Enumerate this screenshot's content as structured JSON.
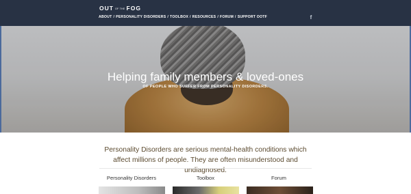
{
  "header": {
    "logo": {
      "word1": "OUT",
      "small": "OF THE",
      "word2": "FOG"
    },
    "nav": [
      "ABOUT",
      "PERSONALITY DISORDERS",
      "TOOLBOX",
      "RESOURCES",
      "FORUM",
      "SUPPORT OOTF"
    ],
    "nav_separator": "/",
    "social_icon": "f"
  },
  "hero": {
    "title": "Helping family members & loved-ones",
    "subtitle": "OF PEOPLE WHO SUFFER FROM PERSONALITY DISORDERS."
  },
  "intro": {
    "text": "Personality Disorders are serious mental-health conditions which affect millions of people. They are often misunderstood and undiagnosed."
  },
  "sections": [
    {
      "title": "Personality Disorders"
    },
    {
      "title": "Toolbox"
    },
    {
      "title": "Forum"
    }
  ],
  "colors": {
    "header_bg": "#283244",
    "intro_text": "#5b4a2f",
    "hero_border": "#4b6a9c"
  }
}
